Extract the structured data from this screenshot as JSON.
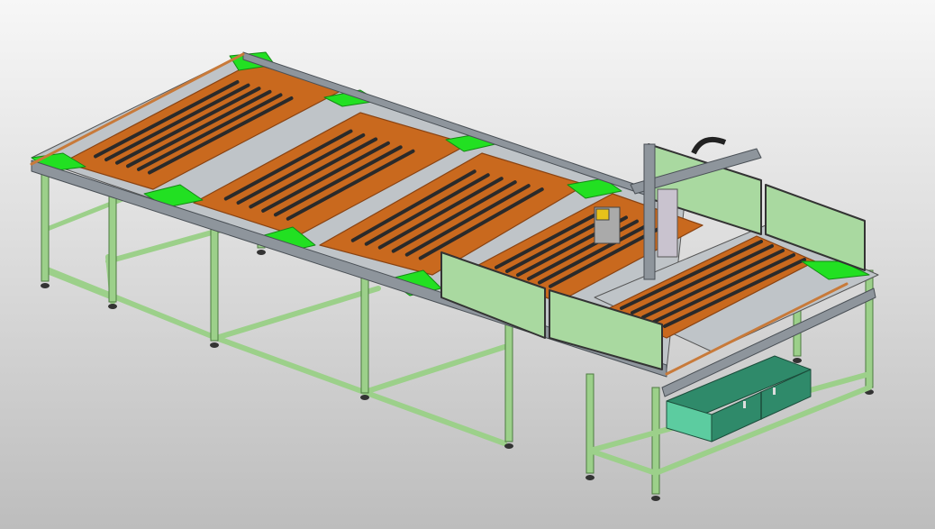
{
  "scene": {
    "subject": "",
    "colors": {
      "background_top": "#f7f7f7",
      "background_bottom": "#bdbdbd",
      "frame": "#9cd08a",
      "frame_dark": "#4d7a40",
      "panel": "#a9d9a0",
      "pallet": "#c9691e",
      "pallet_dark": "#8a4312",
      "conveyor_belt": "#22e022",
      "rail": "#8e959c",
      "rail_dark": "#4a5056",
      "slat": "#2a2a2a",
      "cabinet": "#5ccca0",
      "cabinet_dark": "#2f8a6a",
      "foot": "#333333",
      "accent_yellow": "#e6c21a"
    }
  }
}
